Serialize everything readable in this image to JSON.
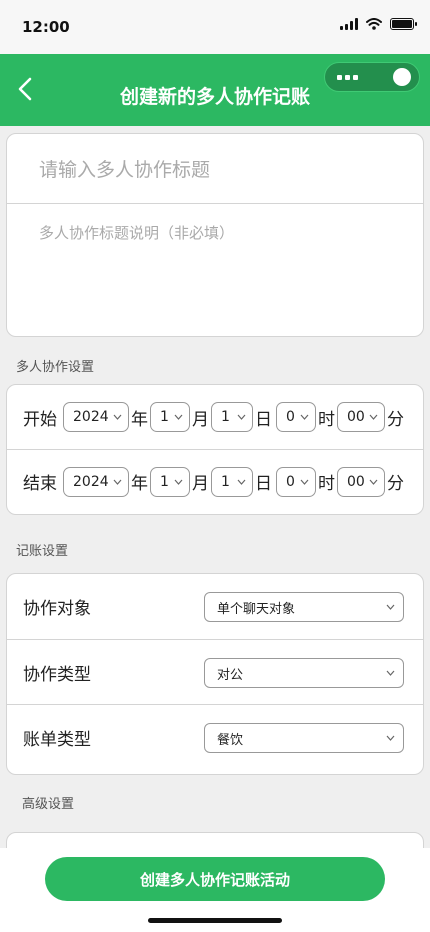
{
  "status": {
    "time": "12:00"
  },
  "header": {
    "title": "创建新的多人协作记账"
  },
  "form": {
    "title_placeholder": "请输入多人协作标题",
    "desc_placeholder": "多人协作标题说明（非必填）"
  },
  "collab_settings": {
    "label": "多人协作设置",
    "start": {
      "label": "开始",
      "year": "2024",
      "month": "1",
      "day": "1",
      "hour": "0",
      "minute": "00"
    },
    "end": {
      "label": "结束",
      "year": "2024",
      "month": "1",
      "day": "1",
      "hour": "0",
      "minute": "00"
    },
    "units": {
      "year": "年",
      "month": "月",
      "day": "日",
      "hour": "时",
      "minute": "分"
    }
  },
  "account_settings": {
    "label": "记账设置",
    "rows": [
      {
        "label": "协作对象",
        "value": "单个聊天对象"
      },
      {
        "label": "协作类型",
        "value": "对公"
      },
      {
        "label": "账单类型",
        "value": "餐饮"
      }
    ]
  },
  "advanced": {
    "label": "高级设置"
  },
  "submit_label": "创建多人协作记账活动",
  "colors": {
    "brand": "#2cb862",
    "background": "#efefef"
  }
}
